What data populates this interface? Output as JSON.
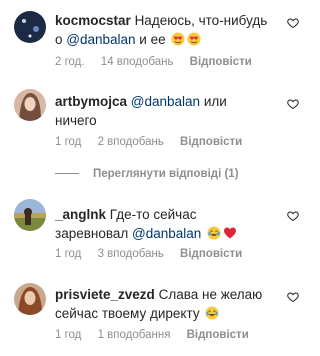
{
  "comments": [
    {
      "username": "kocmocstar",
      "text_before": "Надеюсь, что-нибудь о ",
      "mention": "@danbalan",
      "text_after": " и ее ",
      "emojis": [
        "heart-eyes-emoji",
        "heart-eyes-emoji"
      ],
      "time": "2 год.",
      "likes": "14 вподобань",
      "reply_label": "Відповісти"
    },
    {
      "username": "artbymojca",
      "text_before": "",
      "mention": "@danbalan",
      "text_after": " или ничего",
      "emojis": [],
      "time": "1 год",
      "likes": "2 вподобань",
      "reply_label": "Відповісти",
      "view_replies": "Переглянути відповіді (1)"
    },
    {
      "username": "_anglnk",
      "text_before": "Где-то сейчас заревновал ",
      "mention": "@danbalan",
      "text_after": " ",
      "emojis": [
        "tears-of-joy-emoji",
        "red-heart-emoji"
      ],
      "time": "1 год",
      "likes": "3 вподобань",
      "reply_label": "Відповісти"
    },
    {
      "username": "prisviete_zvezd",
      "text_before": "Слава не желаю сейчас твоему директу ",
      "mention": "",
      "text_after": "",
      "emojis": [
        "tears-of-joy-emoji"
      ],
      "time": "1 год",
      "likes": "1 вподобання",
      "reply_label": "Відповісти"
    }
  ],
  "colors": {
    "text": "#262626",
    "secondary": "#8e8e8e",
    "mention": "#00376b"
  }
}
